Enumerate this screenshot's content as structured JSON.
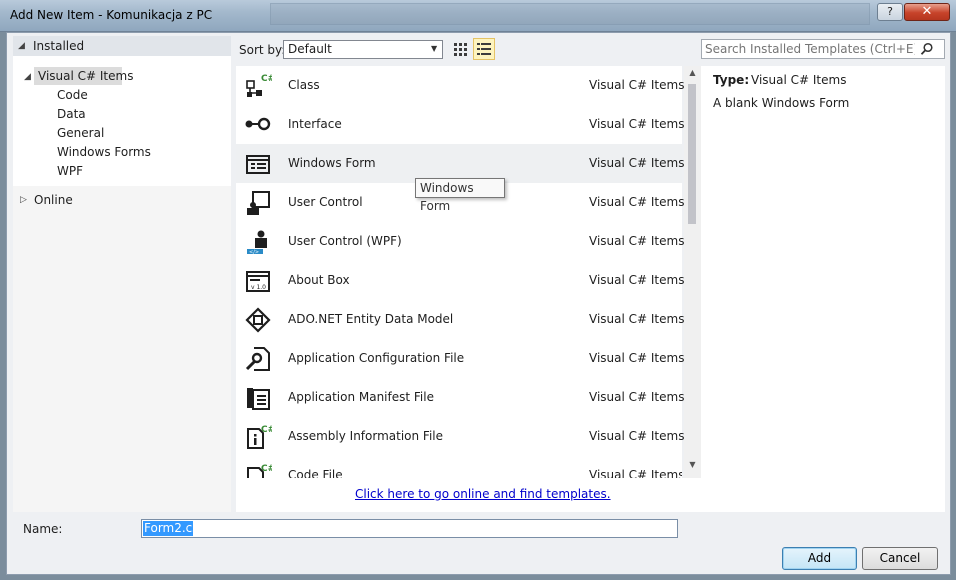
{
  "window": {
    "title": "Add New Item - Komunikacja z PC",
    "help_label": "?",
    "close_label": "✕"
  },
  "tree": {
    "installed": "Installed",
    "visual_csharp": "Visual C# Items",
    "children": [
      "Code",
      "Data",
      "General",
      "Windows Forms",
      "WPF"
    ],
    "online": "Online"
  },
  "sort": {
    "label": "Sort by:",
    "value": "Default"
  },
  "templates": [
    {
      "name": "Class",
      "lang": "Visual C# Items",
      "icon": "class-icon"
    },
    {
      "name": "Interface",
      "lang": "Visual C# Items",
      "icon": "interface-icon"
    },
    {
      "name": "Windows Form",
      "lang": "Visual C# Items",
      "icon": "windows-form-icon"
    },
    {
      "name": "User Control",
      "lang": "Visual C# Items",
      "icon": "user-control-icon"
    },
    {
      "name": "User Control (WPF)",
      "lang": "Visual C# Items",
      "icon": "user-control-wpf-icon"
    },
    {
      "name": "About Box",
      "lang": "Visual C# Items",
      "icon": "about-box-icon"
    },
    {
      "name": "ADO.NET Entity Data Model",
      "lang": "Visual C# Items",
      "icon": "entity-data-model-icon"
    },
    {
      "name": "Application Configuration File",
      "lang": "Visual C# Items",
      "icon": "config-file-icon"
    },
    {
      "name": "Application Manifest File",
      "lang": "Visual C# Items",
      "icon": "manifest-file-icon"
    },
    {
      "name": "Assembly Information File",
      "lang": "Visual C# Items",
      "icon": "assembly-info-icon"
    },
    {
      "name": "Code File",
      "lang": "Visual C# Items",
      "icon": "code-file-icon"
    }
  ],
  "tooltip": "Windows Form",
  "online_link": "Click here to go online and find templates.",
  "search": {
    "placeholder": "Search Installed Templates (Ctrl+E)"
  },
  "details": {
    "type_label": "Type:",
    "type_value": "Visual C# Items",
    "description": "A blank Windows Form"
  },
  "name_field": {
    "label": "Name:",
    "value": "Form2.cs"
  },
  "buttons": {
    "add": "Add",
    "cancel": "Cancel"
  },
  "colors": {
    "selection": "#3399ff",
    "link": "#0000cc",
    "csharp_badge": "#388a34"
  }
}
